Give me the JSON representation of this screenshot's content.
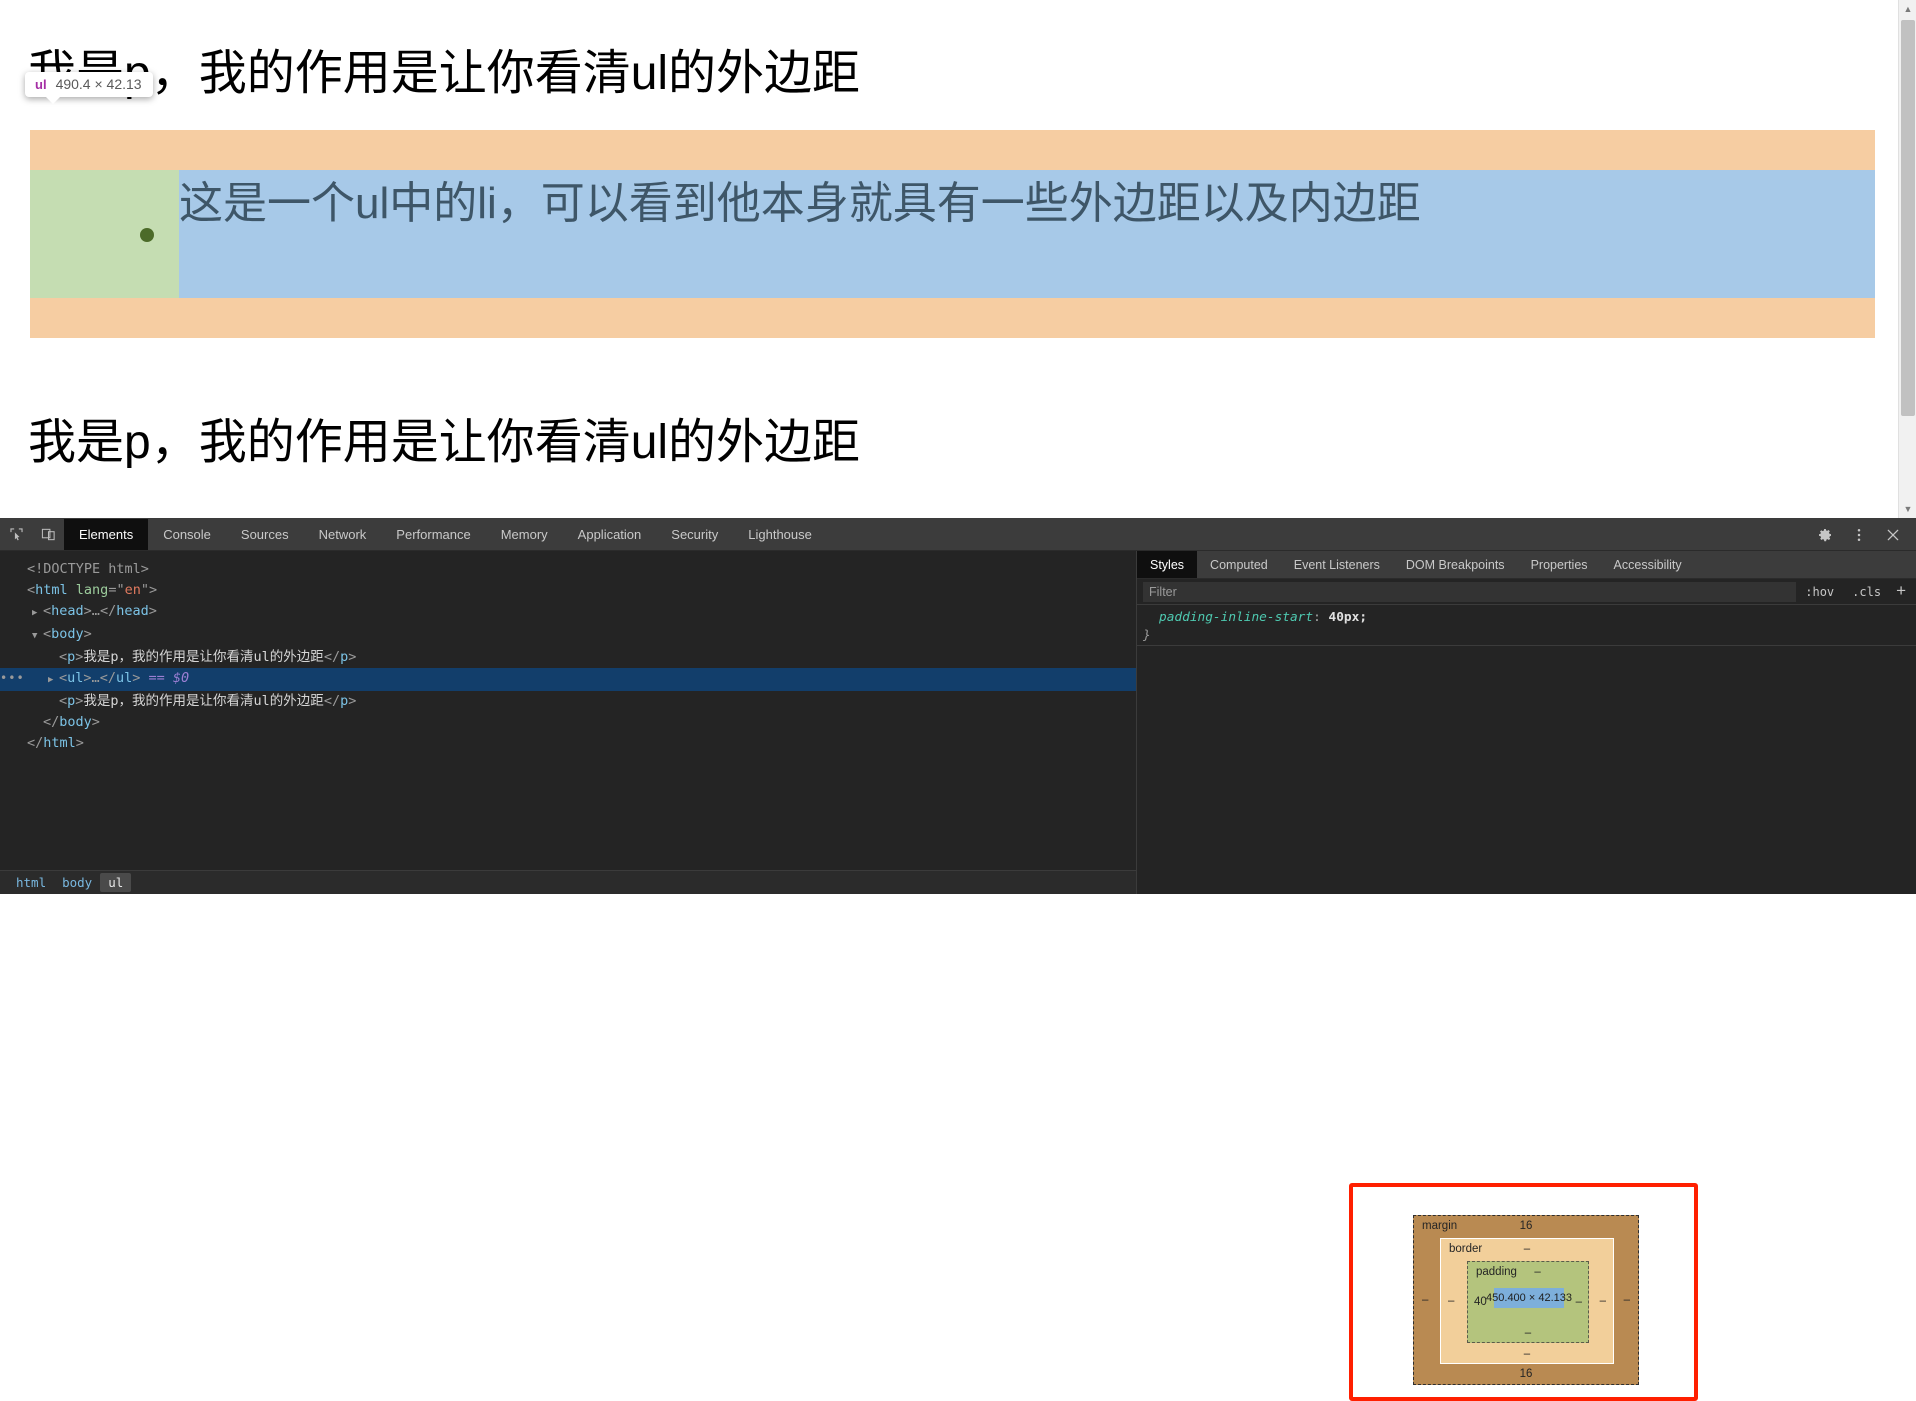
{
  "page": {
    "paragraph_top": "我是p，我的作用是让你看清ul的外边距",
    "paragraph_bottom": "我是p，我的作用是让你看清ul的外边距",
    "list_item": "这是一个ul中的li，可以看到他本身就具有一些外边距以及内边距",
    "tooltip": {
      "tag": "ul",
      "dimensions": "490.4 × 42.13"
    },
    "colors": {
      "margin": "#f6cda2",
      "padding": "#c5ddb2",
      "content": "#a7c9e8",
      "bullet": "#4c6b29",
      "li_text": "#3e5668"
    }
  },
  "devtools": {
    "toolbar": {
      "inspect_icon": "inspect-element-icon",
      "device_icon": "device-toolbar-icon",
      "tabs": [
        {
          "label": "Elements",
          "active": true
        },
        {
          "label": "Console",
          "active": false
        },
        {
          "label": "Sources",
          "active": false
        },
        {
          "label": "Network",
          "active": false
        },
        {
          "label": "Performance",
          "active": false
        },
        {
          "label": "Memory",
          "active": false
        },
        {
          "label": "Application",
          "active": false
        },
        {
          "label": "Security",
          "active": false
        },
        {
          "label": "Lighthouse",
          "active": false
        }
      ],
      "right_icons": [
        "settings-gear-icon",
        "more-options-icon",
        "close-icon"
      ]
    },
    "dom_tree": [
      {
        "indent": 0,
        "triangle": "empty",
        "ellipsis": false,
        "selected": false,
        "parts": [
          {
            "t": "punct",
            "v": "<!DOCTYPE html>"
          }
        ]
      },
      {
        "indent": 0,
        "triangle": "empty",
        "ellipsis": false,
        "selected": false,
        "parts": [
          {
            "t": "punct",
            "v": "<"
          },
          {
            "t": "tag",
            "v": "html"
          },
          {
            "t": "punct",
            "v": " "
          },
          {
            "t": "attr",
            "v": "lang"
          },
          {
            "t": "punct",
            "v": "=\""
          },
          {
            "t": "val",
            "v": "en"
          },
          {
            "t": "punct",
            "v": "\">"
          }
        ]
      },
      {
        "indent": 1,
        "triangle": "closed",
        "ellipsis": false,
        "selected": false,
        "parts": [
          {
            "t": "punct",
            "v": "<"
          },
          {
            "t": "tag",
            "v": "head"
          },
          {
            "t": "punct",
            "v": ">"
          },
          {
            "t": "dots",
            "v": "…"
          },
          {
            "t": "punct",
            "v": "</"
          },
          {
            "t": "tag",
            "v": "head"
          },
          {
            "t": "punct",
            "v": ">"
          }
        ]
      },
      {
        "indent": 1,
        "triangle": "open",
        "ellipsis": false,
        "selected": false,
        "parts": [
          {
            "t": "punct",
            "v": "<"
          },
          {
            "t": "tag",
            "v": "body"
          },
          {
            "t": "punct",
            "v": ">"
          }
        ]
      },
      {
        "indent": 2,
        "triangle": "empty",
        "ellipsis": false,
        "selected": false,
        "parts": [
          {
            "t": "punct",
            "v": "<"
          },
          {
            "t": "tag",
            "v": "p"
          },
          {
            "t": "punct",
            "v": ">"
          },
          {
            "t": "text",
            "v": "我是p，我的作用是让你看清ul的外边距"
          },
          {
            "t": "punct",
            "v": "</"
          },
          {
            "t": "tag",
            "v": "p"
          },
          {
            "t": "punct",
            "v": ">"
          }
        ]
      },
      {
        "indent": 2,
        "triangle": "closed",
        "ellipsis": true,
        "selected": true,
        "parts": [
          {
            "t": "punct",
            "v": "<"
          },
          {
            "t": "tag",
            "v": "ul"
          },
          {
            "t": "punct",
            "v": ">"
          },
          {
            "t": "dots",
            "v": "…"
          },
          {
            "t": "punct",
            "v": "</"
          },
          {
            "t": "tag",
            "v": "ul"
          },
          {
            "t": "punct",
            "v": "> "
          },
          {
            "t": "ref",
            "v": "== $0"
          }
        ]
      },
      {
        "indent": 2,
        "triangle": "empty",
        "ellipsis": false,
        "selected": false,
        "parts": [
          {
            "t": "punct",
            "v": "<"
          },
          {
            "t": "tag",
            "v": "p"
          },
          {
            "t": "punct",
            "v": ">"
          },
          {
            "t": "text",
            "v": "我是p，我的作用是让你看清ul的外边距"
          },
          {
            "t": "punct",
            "v": "</"
          },
          {
            "t": "tag",
            "v": "p"
          },
          {
            "t": "punct",
            "v": ">"
          }
        ]
      },
      {
        "indent": 1,
        "triangle": "empty",
        "ellipsis": false,
        "selected": false,
        "parts": [
          {
            "t": "punct",
            "v": "</"
          },
          {
            "t": "tag",
            "v": "body"
          },
          {
            "t": "punct",
            "v": ">"
          }
        ]
      },
      {
        "indent": 0,
        "triangle": "empty",
        "ellipsis": false,
        "selected": false,
        "parts": [
          {
            "t": "punct",
            "v": "</"
          },
          {
            "t": "tag",
            "v": "html"
          },
          {
            "t": "punct",
            "v": ">"
          }
        ]
      }
    ],
    "breadcrumb": [
      {
        "label": "html",
        "selected": false
      },
      {
        "label": "body",
        "selected": false
      },
      {
        "label": "ul",
        "selected": true
      }
    ],
    "styles": {
      "tabs": [
        {
          "label": "Styles",
          "active": true
        },
        {
          "label": "Computed",
          "active": false
        },
        {
          "label": "Event Listeners",
          "active": false
        },
        {
          "label": "DOM Breakpoints",
          "active": false
        },
        {
          "label": "Properties",
          "active": false
        },
        {
          "label": "Accessibility",
          "active": false
        }
      ],
      "filter_placeholder": "Filter",
      "filter_value": "",
      "hov_label": ":hov",
      "cls_label": ".cls",
      "plus_label": "+",
      "rules": [
        {
          "property": "padding-inline-start",
          "value": "40px;"
        }
      ],
      "closing_brace": "}"
    },
    "box_model": {
      "margin_label": "margin",
      "margin_top": "16",
      "margin_bottom": "16",
      "margin_left": "–",
      "margin_right": "–",
      "border_label": "border",
      "border_top": "–",
      "border_bottom": "–",
      "border_left": "–",
      "border_right": "–",
      "padding_label": "padding",
      "padding_top": "–",
      "padding_bottom": "–",
      "padding_left": "40",
      "padding_right": "–",
      "content_size": "450.400 × 42.133",
      "highlight_color": "#ff1f00"
    }
  }
}
